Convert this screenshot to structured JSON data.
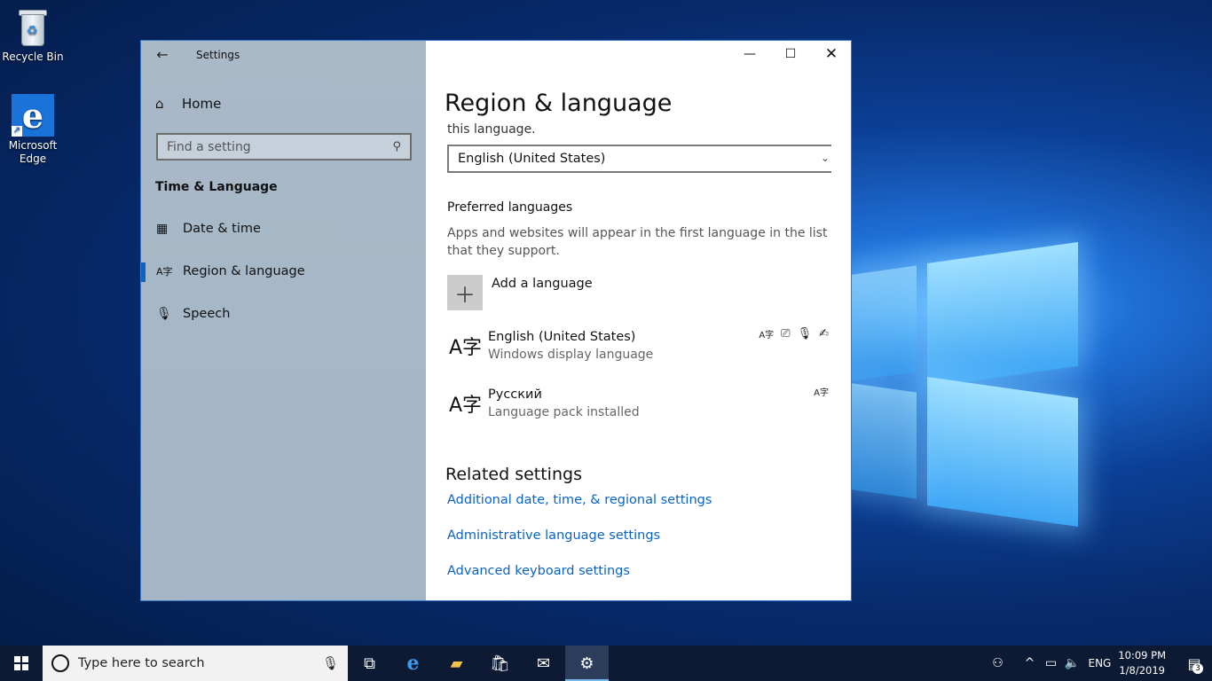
{
  "desktop": {
    "icons": [
      {
        "label": "Recycle Bin"
      },
      {
        "label": "Microsoft Edge"
      }
    ]
  },
  "window": {
    "title": "Settings",
    "sidebar": {
      "home_label": "Home",
      "search_placeholder": "Find a setting",
      "section_title": "Time & Language",
      "items": [
        {
          "label": "Date & time",
          "icon": "calendar-clock-icon"
        },
        {
          "label": "Region & language",
          "icon": "language-icon",
          "active": true
        },
        {
          "label": "Speech",
          "icon": "microphone-icon"
        }
      ]
    },
    "content": {
      "page_title": "Region & language",
      "cut_text": "this language.",
      "dropdown_value": "English (United States)",
      "preferred_title": "Preferred languages",
      "preferred_desc": "Apps and websites will appear in the first language in the list that they support.",
      "add_language_label": "Add a language",
      "languages": [
        {
          "name": "English (United States)",
          "status": "Windows display language"
        },
        {
          "name": "Русский",
          "status": "Language pack installed"
        }
      ],
      "related_title": "Related settings",
      "related_links": [
        "Additional date, time, & regional settings",
        "Administrative language settings",
        "Advanced keyboard settings"
      ]
    }
  },
  "taskbar": {
    "search_placeholder": "Type here to search",
    "input_language": "ENG",
    "time": "10:09 PM",
    "date": "1/8/2019",
    "notification_count": "3"
  },
  "colors": {
    "accent": "#0a64c8",
    "link": "#0b63c1",
    "taskbar": "#0c1a33"
  }
}
